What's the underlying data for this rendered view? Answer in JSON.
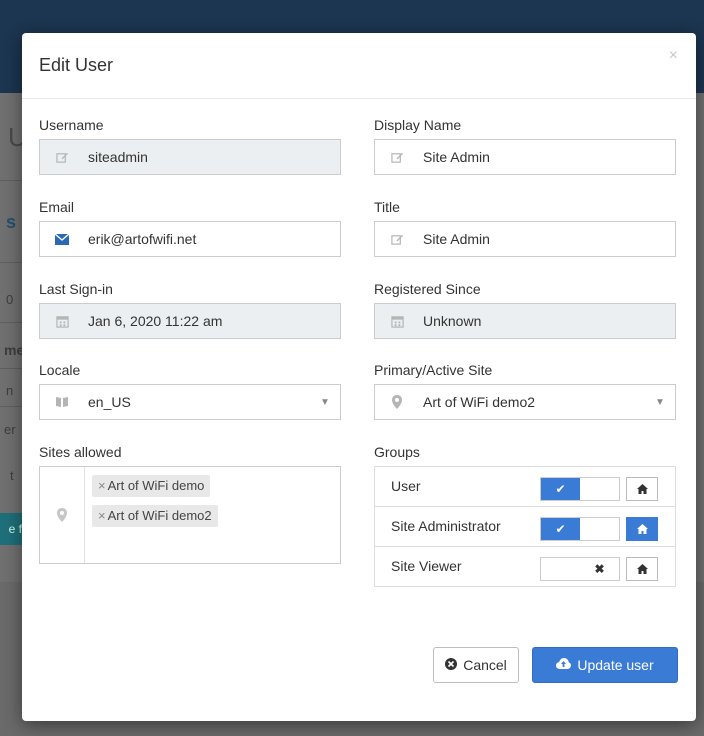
{
  "backdrop": {
    "title_fragment": "U",
    "section_fragment": "s",
    "frag_0": "0",
    "frag_me": "me",
    "frag_n": "n",
    "frag_er": "er",
    "frag_t": "t",
    "button_fragment": "e f"
  },
  "modal": {
    "title": "Edit User",
    "close_glyph": "×"
  },
  "fields": {
    "username": {
      "label": "Username",
      "value": "siteadmin",
      "icon": "pencil-icon"
    },
    "display_name": {
      "label": "Display Name",
      "value": "Site Admin",
      "icon": "pencil-icon"
    },
    "email": {
      "label": "Email",
      "value": "erik@artofwifi.net",
      "icon": "envelope-icon"
    },
    "title": {
      "label": "Title",
      "value": "Site Admin",
      "icon": "pencil-icon"
    },
    "last_signin": {
      "label": "Last Sign-in",
      "value": "Jan 6, 2020 11:22 am",
      "icon": "calendar-icon"
    },
    "registered_since": {
      "label": "Registered Since",
      "value": "Unknown",
      "icon": "calendar-icon"
    },
    "locale": {
      "label": "Locale",
      "value": "en_US",
      "icon": "book-icon"
    },
    "primary_site": {
      "label": "Primary/Active Site",
      "value": "Art of WiFi demo2",
      "icon": "map-marker-icon"
    }
  },
  "sites_allowed": {
    "label": "Sites allowed",
    "tags": [
      {
        "x": "×",
        "text": "Art of WiFi demo"
      },
      {
        "x": "×",
        "text": "Art of WiFi demo2"
      }
    ]
  },
  "groups": {
    "label": "Groups",
    "rows": [
      {
        "name": "User",
        "enabled": true,
        "home_active": false
      },
      {
        "name": "Site Administrator",
        "enabled": true,
        "home_active": true
      },
      {
        "name": "Site Viewer",
        "enabled": false,
        "home_active": false
      }
    ]
  },
  "buttons": {
    "cancel": "Cancel",
    "update": "Update user"
  },
  "colors": {
    "primary": "#3a7bd5",
    "header_bar": "#1c3550",
    "readonly_bg": "#eceff1"
  }
}
